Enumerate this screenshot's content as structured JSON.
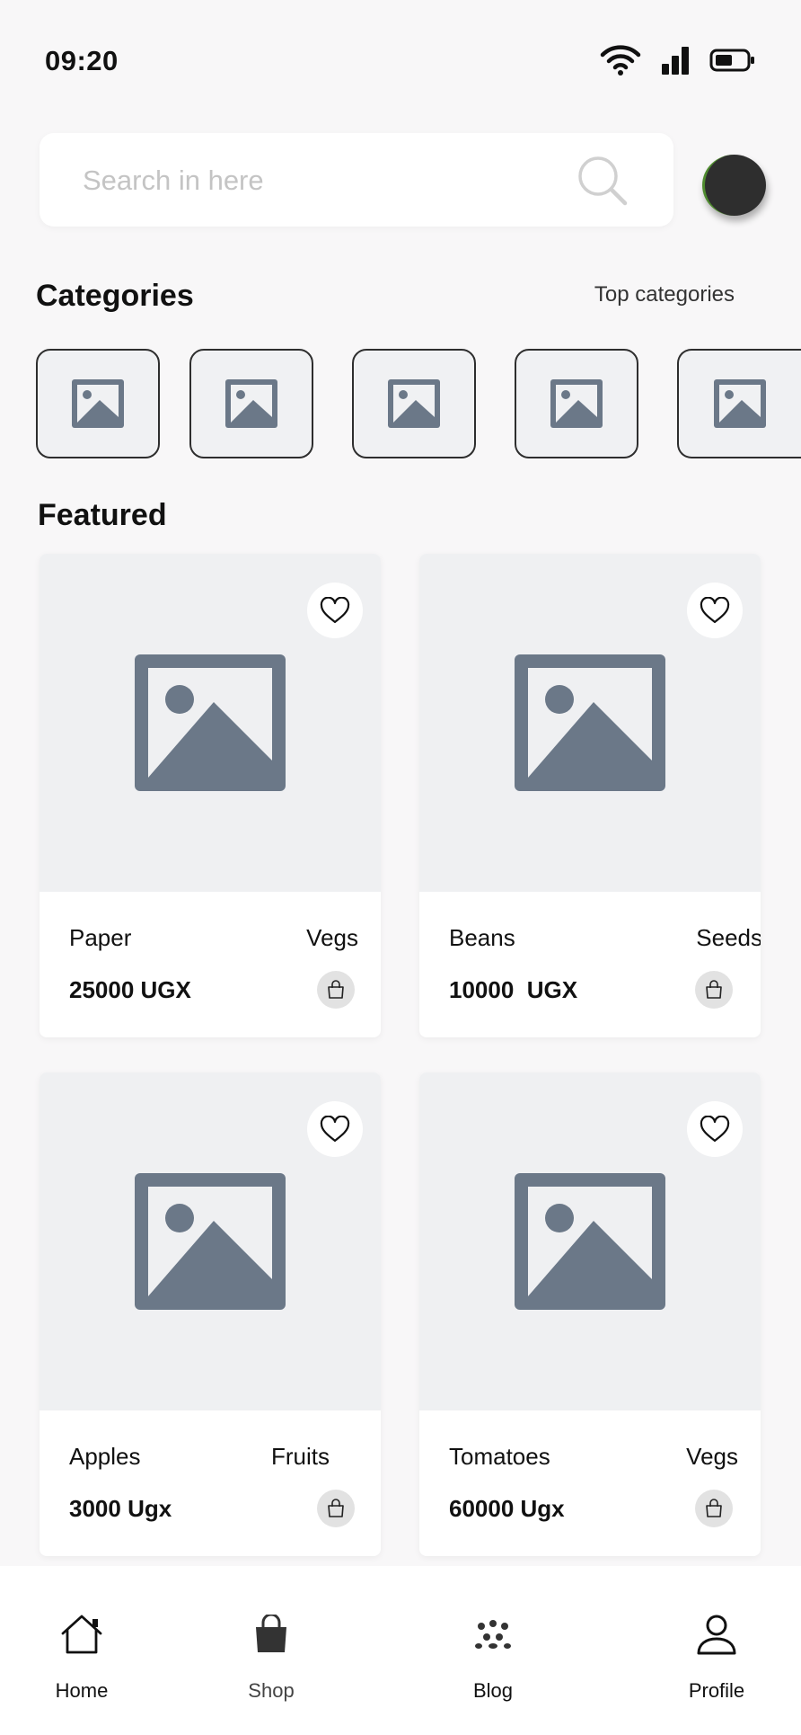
{
  "status_bar": {
    "time": "09:20"
  },
  "search": {
    "placeholder": "Search in here"
  },
  "categories": {
    "title": "Categories",
    "top_link": "Top categories",
    "tiles": [
      {
        "icon": "image-placeholder-icon"
      },
      {
        "icon": "image-placeholder-icon"
      },
      {
        "icon": "image-placeholder-icon"
      },
      {
        "icon": "image-placeholder-icon"
      },
      {
        "icon": "image-placeholder-icon"
      }
    ]
  },
  "featured": {
    "title": "Featured",
    "products": [
      {
        "name": "Paper",
        "category": "Vegs",
        "price": "25000 UGX"
      },
      {
        "name": "Beans",
        "category": "Seeds",
        "price": "10000  UGX"
      },
      {
        "name": "Apples",
        "category": "Fruits",
        "price": "3000 Ugx"
      },
      {
        "name": "Tomatoes",
        "category": "Vegs",
        "price": "60000 Ugx"
      }
    ]
  },
  "nav": {
    "home": "Home",
    "shop": "Shop",
    "blog": "Blog",
    "profile": "Profile"
  },
  "colors": {
    "background": "#f8f7f8",
    "placeholder_icon": "#6b7888",
    "image_bg": "#eff0f2",
    "avatar": "#2e2e2e",
    "avatar_accent": "#4f8b2f"
  }
}
